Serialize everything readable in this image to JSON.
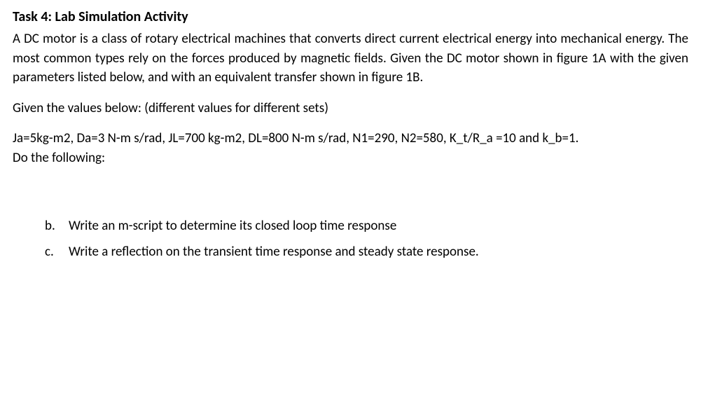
{
  "title": "Task 4: Lab Simulation Activity",
  "intro": "A DC motor is a class of rotary electrical machines that converts direct current electrical energy into mechanical energy. The most common types rely on the forces produced by magnetic fields. Given the DC motor shown in figure 1A with the given parameters listed below, and with an equivalent transfer shown in figure 1B.",
  "given_label": "Given the values below:  (different values for different sets)",
  "values_line": "Ja=5kg-m2, Da=3 N-m s/rad, JL=700 kg-m2, DL=800 N-m s/rad, N1=290, N2=580, K_t/R_a =10 and k_b=1.",
  "do_label": "Do the following:",
  "items": {
    "b": {
      "marker": "b.",
      "text": "Write an m-script to determine its closed loop time response"
    },
    "c": {
      "marker": "c.",
      "text": "Write a reflection on the transient time response and steady state response."
    }
  }
}
